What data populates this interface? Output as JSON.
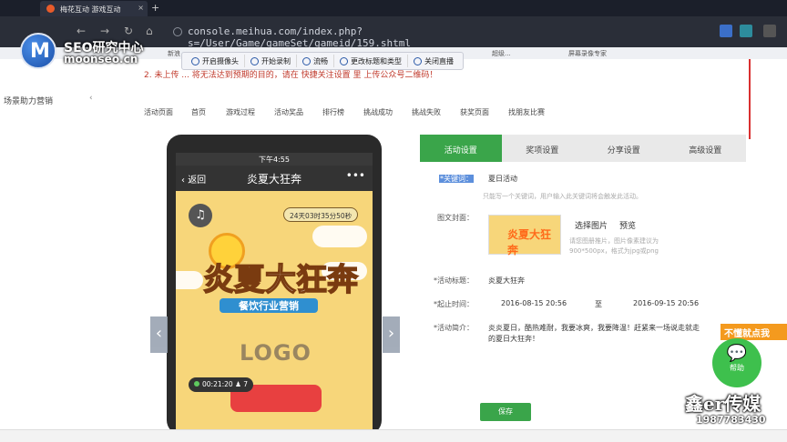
{
  "browser": {
    "tab_title": "梅花互动 游戏互动",
    "tab_close": "×",
    "new_tab": "+",
    "url": "console.meihua.com/index.php?s=/User/Game/gameSet/gameid/159.shtml",
    "back": "←",
    "forward": "→",
    "reload": "↻",
    "home": "⌂",
    "bookmarks": [
      "新浪",
      "超级...",
      "屏幕录像专家"
    ]
  },
  "watermark": {
    "brand_cn": "SEO研究中心",
    "brand_en": "moonseo.cn",
    "logo_letter": "M"
  },
  "recorder": {
    "buttons": [
      "开启摄像头",
      "开始录制",
      "流畅",
      "更改标题和类型",
      "关闭直播"
    ]
  },
  "notice": "2. 未上传 ... 将无法达到预期的目的，请在 快捷关注设置 里 上传公众号二维码！",
  "sidebar": {
    "item": "场景助力营销",
    "chevron": "‹"
  },
  "nav": [
    "活动页面",
    "首页",
    "游戏过程",
    "活动奖品",
    "排行榜",
    "挑战成功",
    "挑战失败",
    "获奖页面",
    "找朋友比赛"
  ],
  "phone": {
    "time": "下午4:55",
    "back": "返回",
    "title": "炎夏大狂奔",
    "more": "•••",
    "countdown": "24天03时35分50秒",
    "banner_main": "炎夏大狂奔",
    "banner_sub": "餐饮行业营销",
    "logo": "LOGO",
    "elapsed": "00:21:20",
    "count": "7"
  },
  "tabs": [
    {
      "label": "活动设置",
      "active": true
    },
    {
      "label": "奖项设置",
      "active": false
    },
    {
      "label": "分享设置",
      "active": false
    },
    {
      "label": "高级设置",
      "active": false
    }
  ],
  "form": {
    "keyword_label": "*关键词：",
    "keyword_value": "夏日活动",
    "keyword_hint": "只能写一个关键词，用户输入此关键词将会触发此活动。",
    "cover_label": "图文封面：",
    "cover_select": "选择图片",
    "cover_preview": "预览",
    "cover_hint1": "请您图册推片，图片像素建议为",
    "cover_hint2": "900*500px，格式为jpg或png",
    "title_label": "*活动标题：",
    "title_value": "炎夏大狂奔",
    "time_label": "*起止时间：",
    "start": "2016-08-15 20:56",
    "to": "至",
    "end": "2016-09-15 20:56",
    "intro_label": "*活动简介：",
    "intro_line1": "炎炎夏日，酷热难耐，我要冰爽，我要降温！赶紧来一场说走就走",
    "intro_line2": "的夏日大狂奔！",
    "save": "保存"
  },
  "widget": {
    "promo": "不懂就点我",
    "help": "帮助"
  },
  "overlay": {
    "name": "鑫er传媒",
    "phone": "1987783430"
  },
  "colors": {
    "accent_green": "#3aa54a",
    "notice_red": "#c0392b",
    "tab_bg": "#1b1f2a"
  }
}
